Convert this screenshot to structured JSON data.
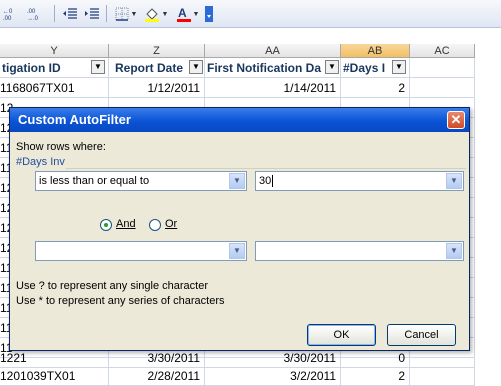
{
  "toolbar": {
    "items": [
      {
        "name": "increase-decimal-icon",
        "glyph": "⁺⁰.00"
      },
      {
        "name": "decrease-decimal-icon",
        "glyph": ".00→.0"
      },
      {
        "name": "decrease-indent-icon",
        "glyph": "⇤≡"
      },
      {
        "name": "increase-indent-icon",
        "glyph": "≡⇥"
      },
      {
        "name": "borders-icon",
        "glyph": "⊞"
      },
      {
        "name": "fill-color-icon",
        "glyph": "◈"
      },
      {
        "name": "font-color-icon",
        "glyph": "A"
      }
    ]
  },
  "columns": {
    "y": "Y",
    "z": "Z",
    "aa": "AA",
    "ab": "AB",
    "ac": "AC"
  },
  "header_row": {
    "y": "tigation ID",
    "z": "Report Date",
    "aa": "First Notification Da",
    "ab": "#Days I"
  },
  "rows": [
    {
      "y": "1168067TX01",
      "z": "1/12/2011",
      "aa": "1/14/2011",
      "ab": "2"
    },
    {
      "y": "12",
      "z": "",
      "aa": "",
      "ab": ""
    },
    {
      "y": "12",
      "z": "",
      "aa": "",
      "ab": ""
    },
    {
      "y": "11",
      "z": "",
      "aa": "",
      "ab": ""
    },
    {
      "y": "11",
      "z": "",
      "aa": "",
      "ab": ""
    },
    {
      "y": "12",
      "z": "",
      "aa": "",
      "ab": ""
    },
    {
      "y": "12",
      "z": "",
      "aa": "",
      "ab": ""
    },
    {
      "y": "12",
      "z": "",
      "aa": "",
      "ab": ""
    },
    {
      "y": "12",
      "z": "",
      "aa": "",
      "ab": ""
    },
    {
      "y": "11",
      "z": "",
      "aa": "",
      "ab": ""
    },
    {
      "y": "11",
      "z": "",
      "aa": "",
      "ab": ""
    },
    {
      "y": "11",
      "z": "",
      "aa": "",
      "ab": ""
    },
    {
      "y": "11",
      "z": "",
      "aa": "",
      "ab": ""
    },
    {
      "y": "11",
      "z": "",
      "aa": "",
      "ab": ""
    },
    {
      "y": "1221",
      "z": "3/30/2011",
      "aa": "3/30/2011",
      "ab": "0"
    },
    {
      "y": "1201039TX01",
      "z": "2/28/2011",
      "aa": "3/2/2011",
      "ab": "2"
    }
  ],
  "dialog": {
    "title": "Custom AutoFilter",
    "show_rows_label": "Show rows where:",
    "field_label": "#Days Inv",
    "condition1": {
      "operator": "is less than or equal to",
      "value": "30"
    },
    "and_label": "And",
    "or_label": "Or",
    "condition2": {
      "operator": "",
      "value": ""
    },
    "hint1": "Use ? to represent any single character",
    "hint2": "Use * to represent any series of characters",
    "ok_label": "OK",
    "cancel_label": "Cancel"
  }
}
